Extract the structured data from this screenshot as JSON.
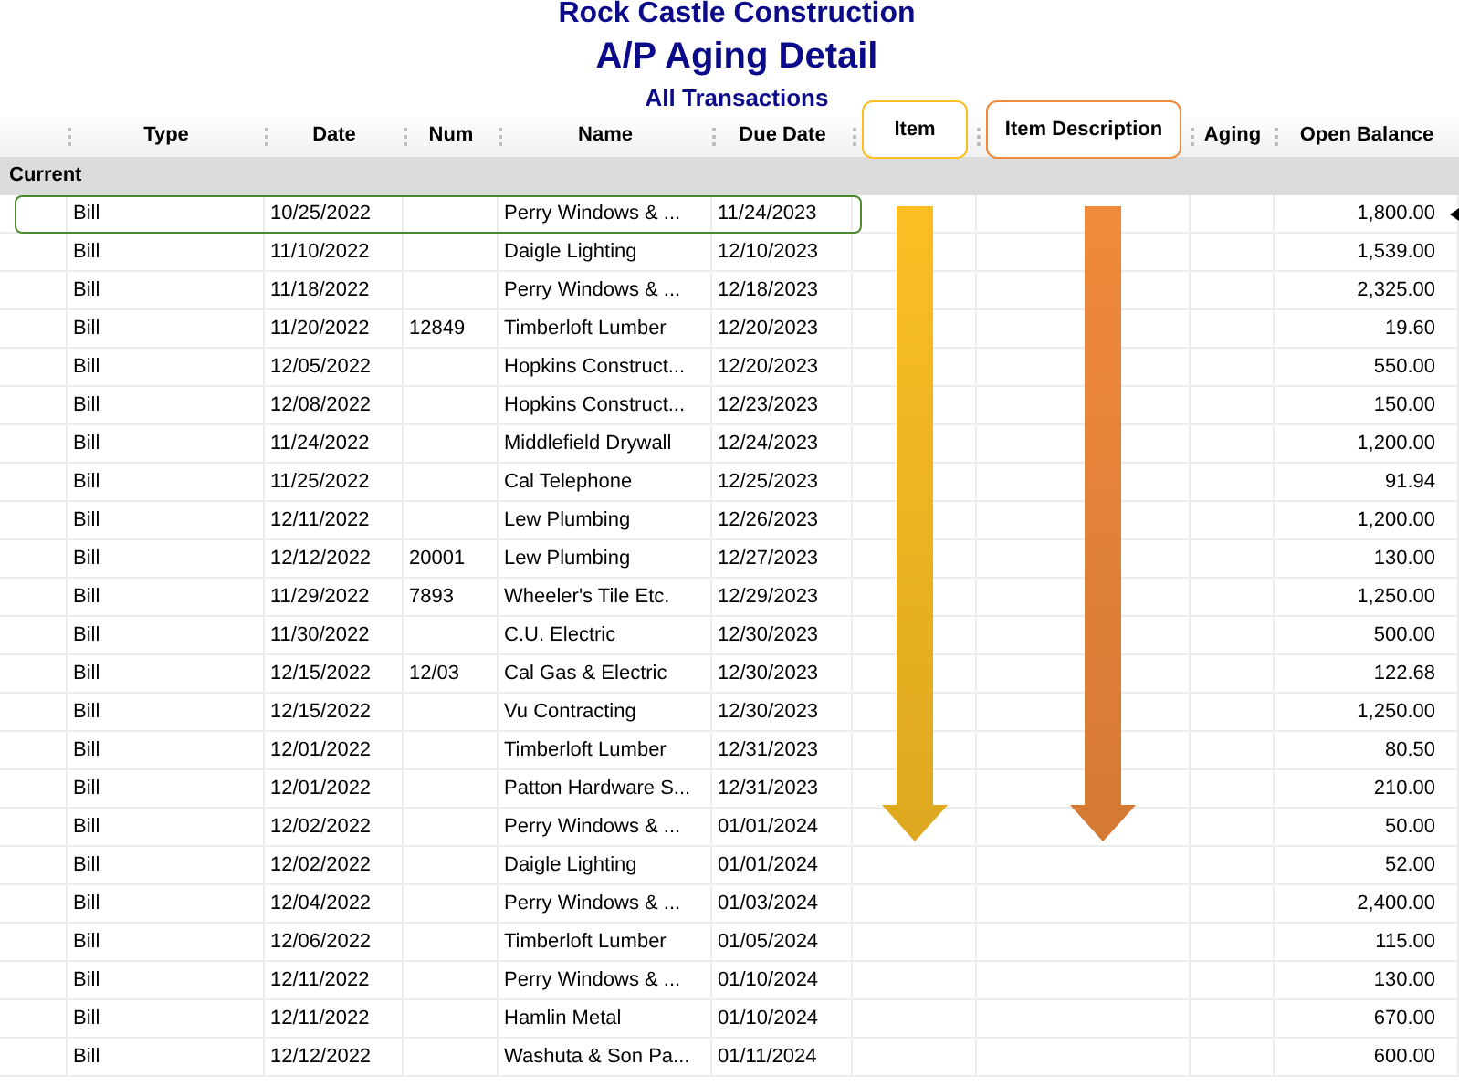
{
  "report": {
    "company": "Rock Castle Construction",
    "title": "A/P Aging Detail",
    "subtitle": "All Transactions"
  },
  "columns": [
    {
      "label": "Type"
    },
    {
      "label": "Date"
    },
    {
      "label": "Num"
    },
    {
      "label": "Name"
    },
    {
      "label": "Due Date"
    },
    {
      "label": "Item",
      "annotation": {
        "color": "#fbbf24"
      }
    },
    {
      "label": "Item Description",
      "annotation": {
        "color": "#f08a3c"
      }
    },
    {
      "label": "Aging"
    },
    {
      "label": "Open Balance"
    }
  ],
  "group": {
    "label": "Current"
  },
  "rows": [
    {
      "type": "Bill",
      "date": "10/25/2022",
      "num": "",
      "name": "Perry Windows & ...",
      "due_date": "11/24/2023",
      "open_balance": "1,800.00",
      "selected": true
    },
    {
      "type": "Bill",
      "date": "11/10/2022",
      "num": "",
      "name": "Daigle Lighting",
      "due_date": "12/10/2023",
      "open_balance": "1,539.00",
      "selected": false
    },
    {
      "type": "Bill",
      "date": "11/18/2022",
      "num": "",
      "name": "Perry Windows & ...",
      "due_date": "12/18/2023",
      "open_balance": "2,325.00",
      "selected": false
    },
    {
      "type": "Bill",
      "date": "11/20/2022",
      "num": "12849",
      "name": "Timberloft Lumber",
      "due_date": "12/20/2023",
      "open_balance": "19.60",
      "selected": false
    },
    {
      "type": "Bill",
      "date": "12/05/2022",
      "num": "",
      "name": "Hopkins Construct...",
      "due_date": "12/20/2023",
      "open_balance": "550.00",
      "selected": false
    },
    {
      "type": "Bill",
      "date": "12/08/2022",
      "num": "",
      "name": "Hopkins Construct...",
      "due_date": "12/23/2023",
      "open_balance": "150.00",
      "selected": false
    },
    {
      "type": "Bill",
      "date": "11/24/2022",
      "num": "",
      "name": "Middlefield Drywall",
      "due_date": "12/24/2023",
      "open_balance": "1,200.00",
      "selected": false
    },
    {
      "type": "Bill",
      "date": "11/25/2022",
      "num": "",
      "name": "Cal Telephone",
      "due_date": "12/25/2023",
      "open_balance": "91.94",
      "selected": false
    },
    {
      "type": "Bill",
      "date": "12/11/2022",
      "num": "",
      "name": "Lew Plumbing",
      "due_date": "12/26/2023",
      "open_balance": "1,200.00",
      "selected": false
    },
    {
      "type": "Bill",
      "date": "12/12/2022",
      "num": "20001",
      "name": "Lew Plumbing",
      "due_date": "12/27/2023",
      "open_balance": "130.00",
      "selected": false
    },
    {
      "type": "Bill",
      "date": "11/29/2022",
      "num": "7893",
      "name": "Wheeler's Tile Etc.",
      "due_date": "12/29/2023",
      "open_balance": "1,250.00",
      "selected": false
    },
    {
      "type": "Bill",
      "date": "11/30/2022",
      "num": "",
      "name": "C.U. Electric",
      "due_date": "12/30/2023",
      "open_balance": "500.00",
      "selected": false
    },
    {
      "type": "Bill",
      "date": "12/15/2022",
      "num": "12/03",
      "name": "Cal Gas & Electric",
      "due_date": "12/30/2023",
      "open_balance": "122.68",
      "selected": false
    },
    {
      "type": "Bill",
      "date": "12/15/2022",
      "num": "",
      "name": "Vu Contracting",
      "due_date": "12/30/2023",
      "open_balance": "1,250.00",
      "selected": false
    },
    {
      "type": "Bill",
      "date": "12/01/2022",
      "num": "",
      "name": "Timberloft Lumber",
      "due_date": "12/31/2023",
      "open_balance": "80.50",
      "selected": false
    },
    {
      "type": "Bill",
      "date": "12/01/2022",
      "num": "",
      "name": "Patton Hardware S...",
      "due_date": "12/31/2023",
      "open_balance": "210.00",
      "selected": false
    },
    {
      "type": "Bill",
      "date": "12/02/2022",
      "num": "",
      "name": "Perry Windows & ...",
      "due_date": "01/01/2024",
      "open_balance": "50.00",
      "selected": false
    },
    {
      "type": "Bill",
      "date": "12/02/2022",
      "num": "",
      "name": "Daigle Lighting",
      "due_date": "01/01/2024",
      "open_balance": "52.00",
      "selected": false
    },
    {
      "type": "Bill",
      "date": "12/04/2022",
      "num": "",
      "name": "Perry Windows & ...",
      "due_date": "01/03/2024",
      "open_balance": "2,400.00",
      "selected": false
    },
    {
      "type": "Bill",
      "date": "12/06/2022",
      "num": "",
      "name": "Timberloft Lumber",
      "due_date": "01/05/2024",
      "open_balance": "115.00",
      "selected": false
    },
    {
      "type": "Bill",
      "date": "12/11/2022",
      "num": "",
      "name": "Perry Windows & ...",
      "due_date": "01/10/2024",
      "open_balance": "130.00",
      "selected": false
    },
    {
      "type": "Bill",
      "date": "12/11/2022",
      "num": "",
      "name": "Hamlin Metal",
      "due_date": "01/10/2024",
      "open_balance": "670.00",
      "selected": false
    },
    {
      "type": "Bill",
      "date": "12/12/2022",
      "num": "",
      "name": "Washuta & Son Pa...",
      "due_date": "01/11/2024",
      "open_balance": "600.00",
      "selected": false
    }
  ]
}
